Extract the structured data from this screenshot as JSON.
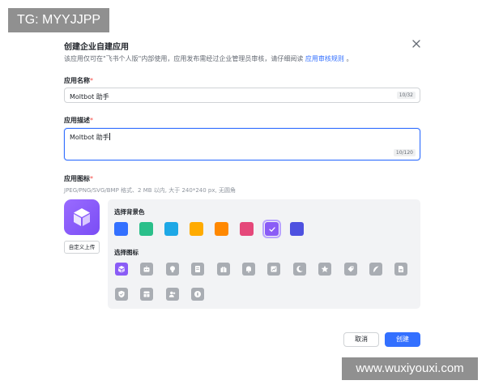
{
  "watermarks": {
    "top_left": "TG: MYYJJPP",
    "bottom_right": "www.wuxiyouxi.com"
  },
  "dialog": {
    "title": "创建企业自建应用",
    "description": "该应用仅可在\"飞书个人版\"内部使用，应用发布需经过企业管理员审核，请仔细阅读",
    "description_link": "应用审核规则",
    "description_end": "。"
  },
  "name_field": {
    "label": "应用名称",
    "required_mark": "*",
    "value": "Moltbot 助手",
    "counter": "10/32"
  },
  "desc_field": {
    "label": "应用描述",
    "required_mark": "*",
    "value": "Moltbot 助手",
    "counter": "10/120"
  },
  "icon_field": {
    "label": "应用图标",
    "required_mark": "*",
    "hint": "JPEG/PNG/SVG/BMP 格式、2 MB 以内, 大于 240*240 px, 无圆角",
    "upload_label": "自定义上传"
  },
  "background_picker": {
    "label": "选择背景色",
    "colors": [
      "#3370ff",
      "#2bbf8a",
      "#1ea8e6",
      "#ffab00",
      "#ff8800",
      "#e5487a",
      "#8a5cf6",
      "#4e51e0"
    ],
    "selected_index": 6
  },
  "icon_picker": {
    "label": "选择图标",
    "icons": [
      "cube-icon",
      "robot-icon",
      "bulb-icon",
      "document-icon",
      "gift-icon",
      "bell-icon",
      "chart-icon",
      "moon-icon",
      "star-icon",
      "tag-icon",
      "feather-icon",
      "file-icon",
      "shield-check-icon",
      "layout-icon",
      "users-icon",
      "compass-icon"
    ],
    "selected_index": 0
  },
  "footer": {
    "cancel_label": "取消",
    "create_label": "创建"
  }
}
